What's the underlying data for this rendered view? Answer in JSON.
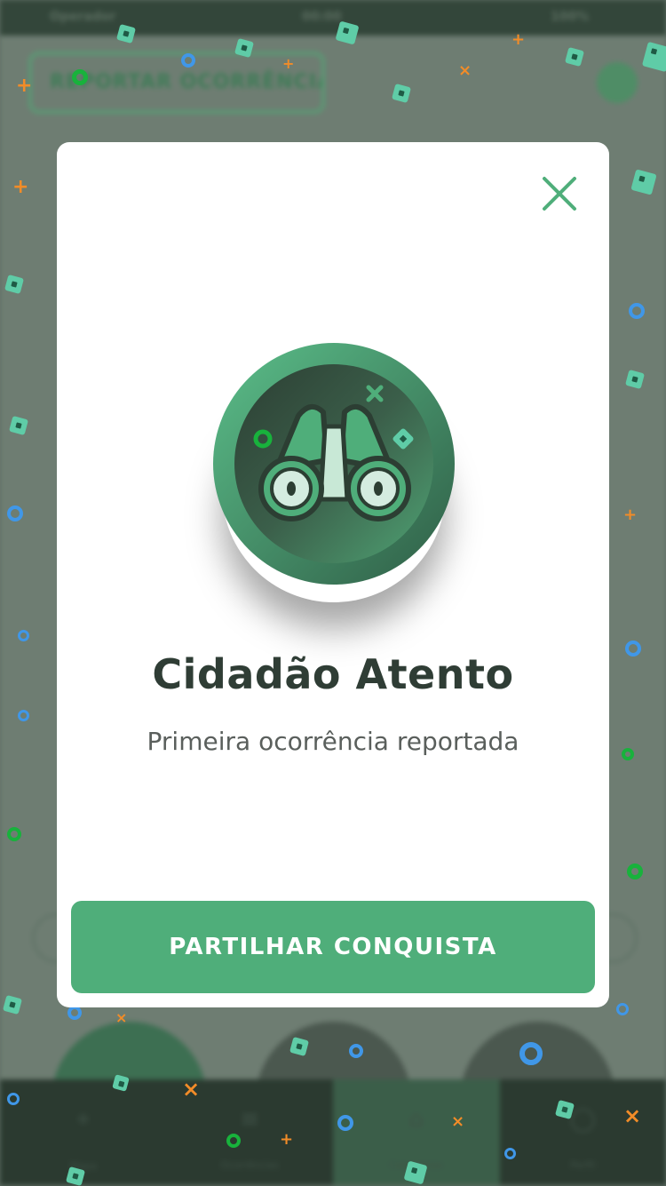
{
  "status_bar": {
    "carrier": "Operador",
    "time": "00:00",
    "battery_label": "100%"
  },
  "background": {
    "report_button_label": "REPORTAR OCORRÊNCIA",
    "nav_items": [
      {
        "icon": "map-icon",
        "glyph": "⌖",
        "label": "Mapa"
      },
      {
        "icon": "list-icon",
        "glyph": "≡",
        "label": "Ocorrências"
      },
      {
        "icon": "trophy-icon",
        "glyph": "⌂",
        "label": "Conquistas"
      },
      {
        "icon": "profile-icon",
        "glyph": "◯",
        "label": "Perfil"
      }
    ]
  },
  "modal": {
    "close_icon": "close-icon",
    "badge_icon": "binoculars-icon",
    "title": "Cidadão Atento",
    "subtitle": "Primeira ocorrência reportada",
    "share_button_label": "PARTILHAR CONQUISTA"
  },
  "colors": {
    "primary_green": "#4fae7a",
    "badge_dark": "#3a4a40",
    "overlay_dim": "#5f6e64",
    "confetti_teal": "#5fcca7",
    "confetti_blue": "#4097e8",
    "confetti_orange": "#f28c28",
    "confetti_green": "#18b23c"
  }
}
